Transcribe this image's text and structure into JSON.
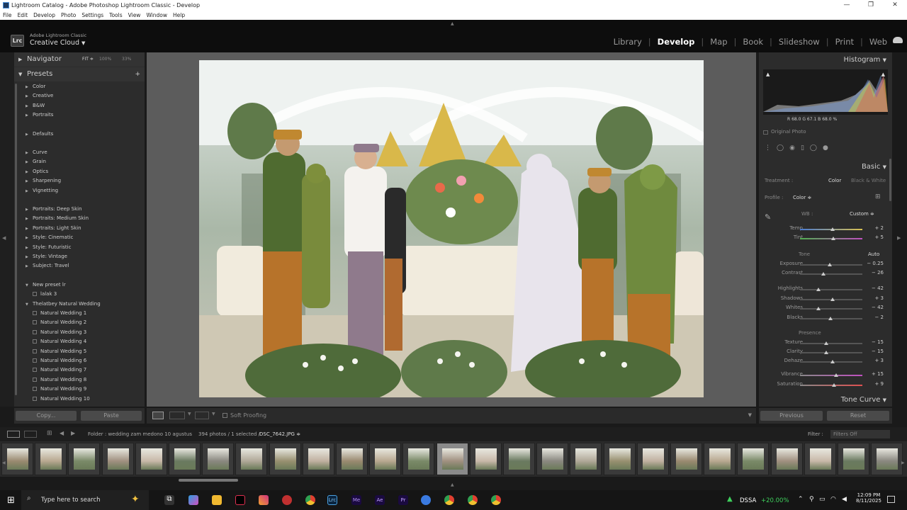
{
  "window": {
    "title": "Lightroom Catalog - Adobe Photoshop Lightroom Classic - Develop",
    "controls": [
      "—",
      "❐",
      "✕"
    ]
  },
  "menu": [
    "File",
    "Edit",
    "Develop",
    "Photo",
    "Settings",
    "Tools",
    "View",
    "Window",
    "Help"
  ],
  "brand": {
    "logo": "Lrc",
    "line1": "Adobe Lightroom Classic",
    "line2": "Creative Cloud"
  },
  "modules": [
    "Library",
    "Develop",
    "Map",
    "Book",
    "Slideshow",
    "Print",
    "Web"
  ],
  "active_module": "Develop",
  "navigator": {
    "title": "Navigator",
    "zoom": [
      "FIT ≑",
      "100%",
      "33%"
    ]
  },
  "presets": {
    "title": "Presets",
    "groups1": [
      "Color",
      "Creative",
      "B&W",
      "Portraits"
    ],
    "groups2": [
      "Defaults"
    ],
    "groups3": [
      "Curve",
      "Grain",
      "Optics",
      "Sharpening",
      "Vignetting"
    ],
    "groups4": [
      "Portraits: Deep Skin",
      "Portraits: Medium Skin",
      "Portraits: Light Skin",
      "Style: Cinematic",
      "Style: Futuristic",
      "Style: Vintage",
      "Subject: Travel"
    ],
    "user_group": "New preset lr",
    "user_item": "lalak 3",
    "natural_group": "Thelatbey Natural Wedding",
    "natural_items": [
      "Natural Wedding 1",
      "Natural Wedding 2",
      "Natural Wedding 3",
      "Natural Wedding 4",
      "Natural Wedding 5",
      "Natural Wedding 6",
      "Natural Wedding 7",
      "Natural Wedding 8",
      "Natural Wedding 9",
      "Natural Wedding 10"
    ]
  },
  "left_buttons": {
    "copy": "Copy...",
    "paste": "Paste"
  },
  "toolbar": {
    "soft_proofing": "Soft Proofing"
  },
  "histogram": {
    "title": "Histogram",
    "readout": "R  68.0  G  67.1  B  68.0 %",
    "original_photo": "Original Photo"
  },
  "basic": {
    "title": "Basic",
    "treatment_label": "Treatment :",
    "treatment_color": "Color",
    "treatment_bw": "Black & White",
    "profile_label": "Profile :",
    "profile_value": "Color ≑",
    "wb_label": "WB :",
    "wb_value": "Custom ≑",
    "tone_label": "Tone",
    "auto_label": "Auto",
    "presence_label": "Presence",
    "sliders_wb": [
      {
        "label": "Temp",
        "value": "+ 2",
        "pos": 0.52
      },
      {
        "label": "Tint",
        "value": "+ 5",
        "pos": 0.53
      }
    ],
    "sliders_tone": [
      {
        "label": "Exposure",
        "value": "− 0.25",
        "pos": 0.48
      },
      {
        "label": "Contrast",
        "value": "− 26",
        "pos": 0.37
      },
      {
        "label": "Highlights",
        "value": "− 42",
        "pos": 0.29
      },
      {
        "label": "Shadows",
        "value": "+ 3",
        "pos": 0.52
      },
      {
        "label": "Whites",
        "value": "− 42",
        "pos": 0.29
      },
      {
        "label": "Blacks",
        "value": "− 2",
        "pos": 0.49
      }
    ],
    "sliders_presence": [
      {
        "label": "Texture",
        "value": "− 15",
        "pos": 0.42
      },
      {
        "label": "Clarity",
        "value": "− 15",
        "pos": 0.42
      },
      {
        "label": "Dehaze",
        "value": "+ 3",
        "pos": 0.52
      },
      {
        "label": "Vibrance",
        "value": "+ 15",
        "pos": 0.58
      },
      {
        "label": "Saturation",
        "value": "+ 9",
        "pos": 0.55
      }
    ]
  },
  "tone_curve": "Tone Curve",
  "right_buttons": {
    "previous": "Previous",
    "reset": "Reset"
  },
  "filmstrip_header": {
    "folder": "Folder : wedding zam medono 10 agustus",
    "count": "394 photos / 1 selected /",
    "file": "DSC_7642.JPG ≑",
    "filter_label": "Filter :",
    "filter_value": "Filters Off"
  },
  "taskbar": {
    "search": "Search",
    "search_placeholder": "Type here to search",
    "ticker_name": "DSSA",
    "ticker_change": "+20.00%",
    "time": "12:09 PM",
    "date": "8/11/2025"
  },
  "colors": {
    "accent_green": "#3ecf5c",
    "panel": "#2c2c2c",
    "center": "#5c5c5c"
  }
}
